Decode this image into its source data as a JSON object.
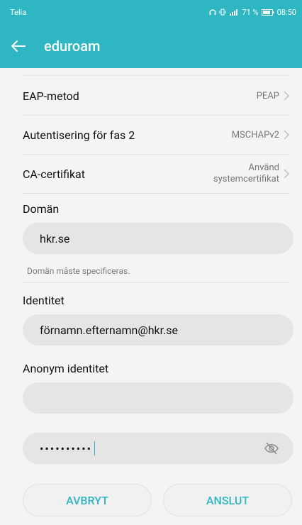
{
  "status": {
    "carrier": "Telia",
    "battery": "71 %",
    "time": "08:50"
  },
  "header": {
    "title": "eduroam"
  },
  "settings": {
    "eap_method": {
      "label": "EAP-metod",
      "value": "PEAP"
    },
    "phase2": {
      "label": "Autentisering för fas 2",
      "value": "MSCHAPv2"
    },
    "ca_cert": {
      "label": "CA-certifikat",
      "value_line1": "Använd",
      "value_line2": "systemcertifikat"
    }
  },
  "domain": {
    "label": "Domän",
    "value": "hkr.se",
    "helper": "Domän måste specificeras."
  },
  "identity": {
    "label": "Identitet",
    "value": "förnamn.efternamn@hkr.se"
  },
  "anonymous": {
    "label": "Anonym identitet",
    "value": ""
  },
  "password": {
    "masked": "••••••••••"
  },
  "actions": {
    "cancel": "AVBRYT",
    "connect": "ANSLUT"
  },
  "colors": {
    "accent": "#2eb6c2",
    "field_bg": "#e5e5e5",
    "background": "#f4f4f4"
  }
}
